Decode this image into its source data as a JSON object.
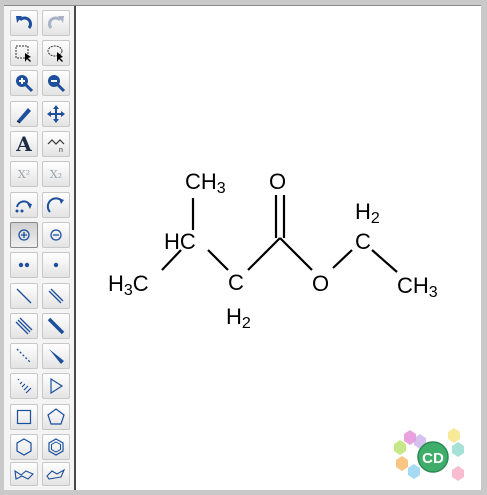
{
  "toolbar": {
    "text_tool_label": "A",
    "superscript_label": "X²",
    "subscript_label": "X₂",
    "buttons": [
      {
        "name": "undo-button",
        "icon": "undo-icon"
      },
      {
        "name": "redo-button",
        "icon": "redo-icon"
      },
      {
        "name": "rect-select-button",
        "icon": "rect-select-icon"
      },
      {
        "name": "lasso-select-button",
        "icon": "lasso-icon"
      },
      {
        "name": "zoom-in-button",
        "icon": "zoom-in-icon"
      },
      {
        "name": "zoom-out-button",
        "icon": "zoom-out-icon"
      },
      {
        "name": "eraser-button",
        "icon": "eraser-icon"
      },
      {
        "name": "move-button",
        "icon": "move-icon"
      },
      {
        "name": "text-button",
        "icon": "text-icon"
      },
      {
        "name": "chain-button",
        "icon": "chain-icon"
      },
      {
        "name": "superscript-button",
        "icon": "superscript-icon"
      },
      {
        "name": "subscript-button",
        "icon": "subscript-icon"
      },
      {
        "name": "rotate-left-button",
        "icon": "rotate-left-icon"
      },
      {
        "name": "rotate-right-button",
        "icon": "rotate-right-icon"
      },
      {
        "name": "positive-charge-button",
        "icon": "plus-charge-icon"
      },
      {
        "name": "negative-charge-button",
        "icon": "minus-charge-icon"
      },
      {
        "name": "lone-pair-button",
        "icon": "lone-pair-icon"
      },
      {
        "name": "radical-button",
        "icon": "radical-icon"
      },
      {
        "name": "single-bond-button",
        "icon": "single-bond-icon"
      },
      {
        "name": "double-bond-button",
        "icon": "double-bond-icon"
      },
      {
        "name": "triple-bond-button",
        "icon": "triple-bond-icon"
      },
      {
        "name": "bold-bond-button",
        "icon": "bold-bond-icon"
      },
      {
        "name": "dashed-bond-button",
        "icon": "dashed-bond-icon"
      },
      {
        "name": "wedge-bond-button",
        "icon": "wedge-bond-icon"
      },
      {
        "name": "hashed-wedge-button",
        "icon": "hashed-wedge-icon"
      },
      {
        "name": "cyclopropane-button",
        "icon": "triangle-icon"
      },
      {
        "name": "cyclobutane-button",
        "icon": "square-icon"
      },
      {
        "name": "cyclopentane-button",
        "icon": "pentagon-icon"
      },
      {
        "name": "cyclohexane-button",
        "icon": "hexagon-icon"
      },
      {
        "name": "benzene-button",
        "icon": "benzene-icon"
      },
      {
        "name": "chair-cyclohexane-1-button",
        "icon": "chair-icon"
      },
      {
        "name": "chair-cyclohexane-2-button",
        "icon": "chair-alt-icon"
      }
    ]
  },
  "molecule": {
    "atoms": {
      "ch3_top": {
        "symbol": "CH",
        "sub": "3"
      },
      "hc": {
        "symbol": "HC"
      },
      "h3c_left_prefix": "H",
      "h3c_left_sub": "3",
      "h3c_left_symbol": "C",
      "ch2_c": "C",
      "ch2_h": "H",
      "ch2_sub": "2",
      "carbonyl_o": "O",
      "ester_o": "O",
      "ethyl_h": "H",
      "ethyl_sub": "2",
      "ethyl_c": "C",
      "ch3_right": {
        "symbol": "CH",
        "sub": "3"
      }
    }
  },
  "logo": {
    "text": "CD",
    "icon": "chemdoodle-logo-icon"
  }
}
